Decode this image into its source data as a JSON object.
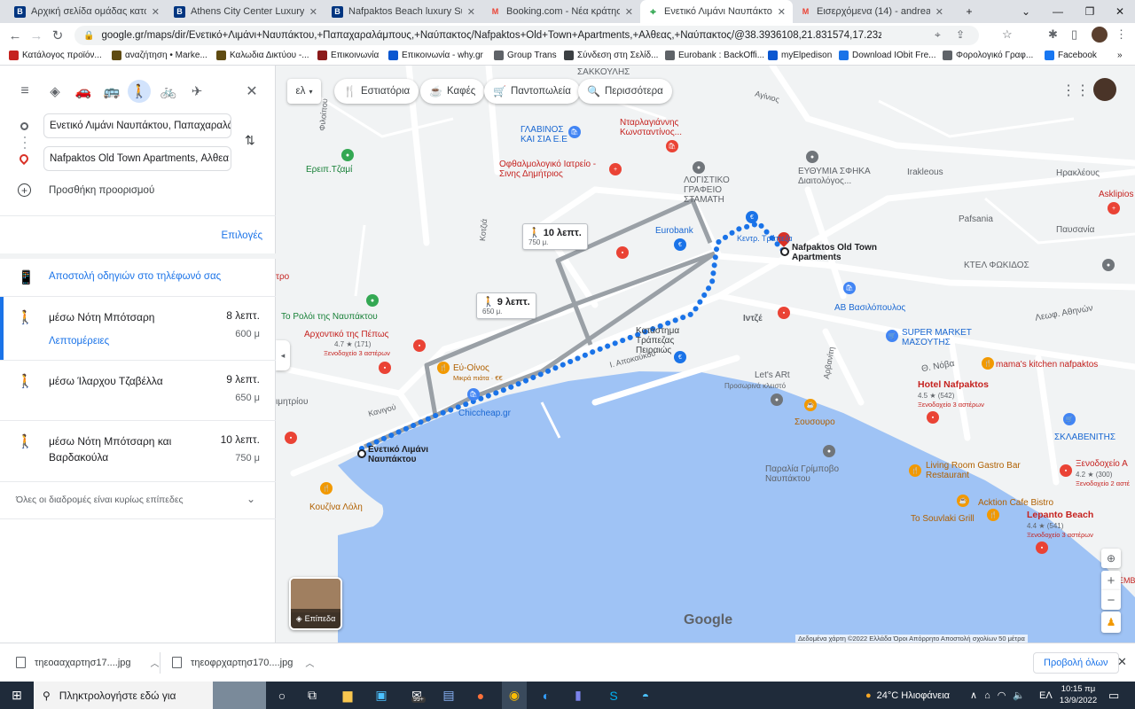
{
  "browser": {
    "tabs": [
      {
        "title": "Αρχική σελίδα ομάδας καταλυ",
        "icon": "B",
        "color": "#003580"
      },
      {
        "title": "Athens City Center Luxury Suite",
        "icon": "B",
        "color": "#003580"
      },
      {
        "title": "Nafpaktos Beach luxury Suites",
        "icon": "B",
        "color": "#003580"
      },
      {
        "title": "Booking.com - Νέα κράτηση! (2",
        "icon": "M",
        "color": "#ea4335"
      },
      {
        "title": "Ενετικό Λιμάνι Ναυπάκτου πρ",
        "icon": "maps",
        "color": "#34a853"
      },
      {
        "title": "Εισερχόμενα (14) - andreaskal",
        "icon": "M",
        "color": "#ea4335"
      }
    ],
    "url": "google.gr/maps/dir/Ενετικό+Λιμάνι+Ναυπάκτου,+Παπαχαραλάμπους,+Ναύπακτος/Nafpaktos+Old+Town+Apartments,+Αλθεας,+Ναύπακτος/@38.3936108,21.831574,17.23z/data=!4m14!4m13!1m5!...",
    "bookmarks": [
      {
        "label": "Κατάλογος προϊόν...",
        "color": "#c5221f"
      },
      {
        "label": "αναζήτηση • Marke...",
        "color": "#5f4b12"
      },
      {
        "label": "Καλωδια Δικτύου -...",
        "color": "#5f4b12"
      },
      {
        "label": "Επικοινωνία",
        "color": "#8b1a1a"
      },
      {
        "label": "Επικοινωνία - why.gr",
        "color": "#0b57d0"
      },
      {
        "label": "Group Trans",
        "color": "#5f6368"
      },
      {
        "label": "Σύνδεση στη Σελίδ...",
        "color": "#3c4043"
      },
      {
        "label": "Eurobank : BackOffi...",
        "color": "#5f6368"
      },
      {
        "label": "myElpedison",
        "color": "#0b57d0"
      },
      {
        "label": "Download IObit Fre...",
        "color": "#1a73e8"
      },
      {
        "label": "Φορολογικό Γραφ...",
        "color": "#5f6368"
      },
      {
        "label": "Facebook",
        "color": "#1877f2"
      }
    ]
  },
  "panel": {
    "origin": "Ενετικό Λιμάνι Ναυπάκτου, Παπαχαραλά",
    "destination": "Nafpaktos Old Town Apartments, Αλθεα",
    "add_destination": "Προσθήκη προορισμού",
    "options": "Επιλογές",
    "send_to_phone": "Αποστολή οδηγιών στο τηλέφωνό σας",
    "routes": [
      {
        "via": "μέσω Νότη Μπότσαρη",
        "time": "8 λεπτ.",
        "dist": "600 μ",
        "details": "Λεπτομέρειες",
        "selected": true
      },
      {
        "via": "μέσω Ίλαρχου Τζαβέλλα",
        "time": "9 λεπτ.",
        "dist": "650 μ",
        "details": "",
        "selected": false
      },
      {
        "via": "μέσω Νότη Μπότσαρη και Βαρδακούλα",
        "time": "10 λεπτ.",
        "dist": "750 μ",
        "details": "",
        "selected": false
      }
    ],
    "flat_note": "Όλες οι διαδρομές είναι κυρίως επίπεδες"
  },
  "map": {
    "chips": [
      {
        "label": "Εστιατόρια",
        "icon": "🍴"
      },
      {
        "label": "Καφές",
        "icon": "☕"
      },
      {
        "label": "Παντοπωλεία",
        "icon": "🛒"
      },
      {
        "label": "Περισσότερα",
        "icon": "🔍"
      }
    ],
    "lang": "ελ",
    "bubble1": {
      "time": "10 λεπτ.",
      "dist": "750 μ."
    },
    "bubble2": {
      "time": "9 λεπτ.",
      "dist": "650 μ."
    },
    "start_label": "Ενετικό Λιμάνι Ναυπάκτου",
    "end_label": "Nafpaktos Old Town Apartments",
    "labels": {
      "sakkoulis": "ΣΑΚΚΟΥΛΗΣ",
      "glavinos": "ΓΛΑΒΙΝΟΣ ΚΑΙ ΣΙΑ Ε.Ε",
      "ntarlagiannis": "Νταρλαγιάννης Κωνσταντίνος...",
      "ofthalmo": "Οφθαλμολογικό Ιατρείο - Σινης Δημήτριος",
      "logistiko": "ΛΟΓΙΣΤΙΚΟ ΓΡΑΦΕΙΟ ΣΤΑΜΑΤΗ",
      "efthymia": "ΕΥΘΥΜΙΑ ΣΦΗΚΑ Διαιτολόγος...",
      "irakleous1": "Irakleous",
      "irakleous2": "Ηρακλέους",
      "asklipios": "Asklipios",
      "pafsania": "Pafsania",
      "pafsanias": "Παυσανία",
      "eurobank": "Eurobank",
      "kentro": "Κεντρ. Τράπεζα",
      "ktel": "ΚΤΕΛ ΦΩΚΙΔΟΣ",
      "ereip": "Ερειπ.Τζαμί",
      "roloi": "Το Ρολόι της Ναυπάκτου",
      "archontiko": "Αρχοντικό της Πέπως",
      "archontiko_rating": "4.7 ★ (171)",
      "archontiko_cat": "Ξενοδοχείο 3 αστέρων",
      "ab": "ΑΒ Βασιλόπουλος",
      "intze": "Ιντζέ",
      "leof": "Λεωφ. Αθηνών",
      "supermarket": "SUPER MARKET ΜΑΣΟΥΤΗΣ",
      "noba": "Θ. Νόβα",
      "mamas": "mama's kitchen nafpaktos",
      "katastima": "Κατάστημα Τράπεζας Πειραιώς",
      "eu_oinos": "Εύ-Οίνος",
      "eu_oinos_sub": "Μικρά πιάτα · €€",
      "apokaukou": "Ι. Αποκαύκου",
      "letsart": "Let's ARt",
      "letsart_sub": "Προσωρινά κλειστό",
      "arbanitis": "Αρβανίτη",
      "hotel_naf": "Hotel Nafpaktos",
      "hotel_naf_rating": "4.5 ★ (542)",
      "hotel_naf_cat": "Ξενοδοχείο 3 αστέρων",
      "sousouro": "Σουσουρο",
      "sklavenitis": "ΣΚΛΑΒΕΝΙΤΗΣ",
      "chiccheap": "Chiccheap.gr",
      "kanigou": "Κανιγού",
      "paralia": "Παραλία Γρίμποβο Ναυπάκτου",
      "livingroom": "Living Room Gastro Bar Restaurant",
      "acktion": "Acktion Cafe Bistro",
      "souvlaki": "To Souvlaki Grill",
      "xenodocheio": "Ξενοδοχείο Α",
      "xenodocheio_rating": "4.2 ★ (300)",
      "xenodocheio_cat": "Ξενοδοχείο 2 αστέ",
      "lepanto": "Lepanto Beach",
      "lepanto_rating": "4.4 ★ (541)",
      "lepanto_cat": "Ξενοδοχείο 3 αστέρων",
      "kouzina": "Κουζίνα Λόλη",
      "mitriou": "ιμητρίου",
      "tro": "τρο",
      "filoipou": "Φιλοίπου",
      "kotsomi": "Κοτζιά",
      "avinos": "Αγίνιος",
      "emb": "ΕΜΒ"
    },
    "layers": "Επίπεδα",
    "google": "Google",
    "footer": "Δεδομένα χάρτη ©2022    Ελλάδα    Όροι    Απόρρητο    Αποστολή σχολίων    50 μέτρα"
  },
  "downloads": {
    "items": [
      "τηεοααχαρτησ17....jpg",
      "τηεοφρχαρτησ170....jpg"
    ],
    "show_all": "Προβολή όλων"
  },
  "taskbar": {
    "search": "Πληκτρολογήστε εδώ για",
    "weather": "24°C  Ηλιοφάνεια",
    "lang": "ΕΛ",
    "time": "10:15 πμ",
    "date": "13/9/2022",
    "badge": "99+"
  }
}
